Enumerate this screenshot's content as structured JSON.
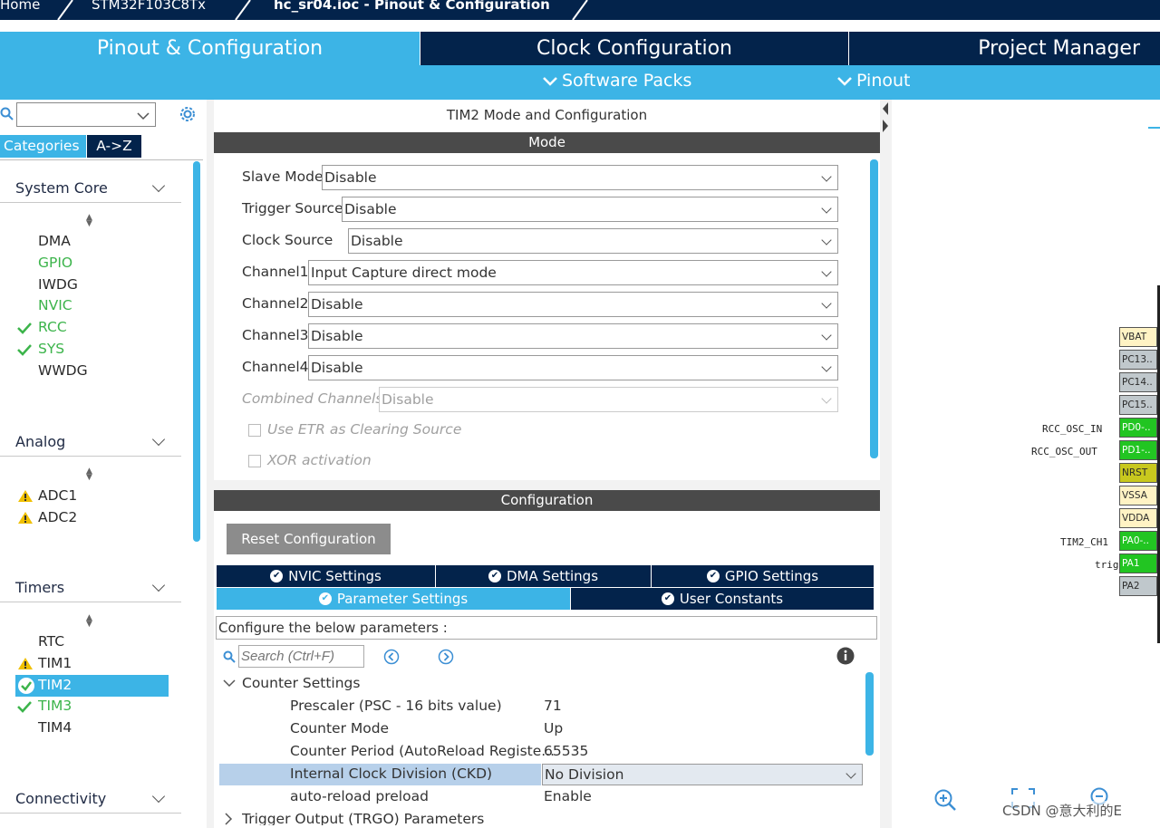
{
  "breadcrumb": {
    "home": "Home",
    "chip": "STM32F103C8Tx",
    "file": "hc_sr04.ioc - Pinout & Configuration"
  },
  "main_tabs": [
    {
      "label": "Pinout & Configuration",
      "active": true
    },
    {
      "label": "Clock Configuration",
      "active": false
    },
    {
      "label": "Project Manager",
      "active": false
    }
  ],
  "subbar": {
    "software_packs": "Software Packs",
    "pinout": "Pinout"
  },
  "sidebar": {
    "search_value": "",
    "tab_categories": "Categories",
    "tab_az": "A->Z",
    "sections": [
      {
        "title": "System Core",
        "items": [
          {
            "label": "DMA",
            "status": "none"
          },
          {
            "label": "GPIO",
            "status": "green"
          },
          {
            "label": "IWDG",
            "status": "none"
          },
          {
            "label": "NVIC",
            "status": "green"
          },
          {
            "label": "RCC",
            "status": "check"
          },
          {
            "label": "SYS",
            "status": "check"
          },
          {
            "label": "WWDG",
            "status": "none"
          }
        ]
      },
      {
        "title": "Analog",
        "items": [
          {
            "label": "ADC1",
            "status": "warning"
          },
          {
            "label": "ADC2",
            "status": "warning"
          }
        ]
      },
      {
        "title": "Timers",
        "items": [
          {
            "label": "RTC",
            "status": "none"
          },
          {
            "label": "TIM1",
            "status": "warning"
          },
          {
            "label": "TIM2",
            "status": "selected-check"
          },
          {
            "label": "TIM3",
            "status": "check"
          },
          {
            "label": "TIM4",
            "status": "none"
          }
        ]
      },
      {
        "title": "Connectivity",
        "items": []
      }
    ]
  },
  "mode_panel": {
    "title": "TIM2 Mode and Configuration",
    "mode_header": "Mode",
    "fields": [
      {
        "label": "Slave Mode",
        "value": "Disable"
      },
      {
        "label": "Trigger Source",
        "value": "Disable"
      },
      {
        "label": "Clock Source",
        "value": "Disable"
      },
      {
        "label": "Channel1",
        "value": "Input Capture direct mode"
      },
      {
        "label": "Channel2",
        "value": "Disable"
      },
      {
        "label": "Channel3",
        "value": "Disable"
      },
      {
        "label": "Channel4",
        "value": "Disable"
      },
      {
        "label": "Combined Channels",
        "value": "Disable"
      }
    ],
    "checkbox_etr": "Use ETR as Clearing Source",
    "checkbox_xor": "XOR activation"
  },
  "config_panel": {
    "header": "Configuration",
    "reset_button": "Reset Configuration",
    "tabs_row1": [
      "NVIC Settings",
      "DMA Settings",
      "GPIO Settings"
    ],
    "tabs_row2": [
      "Parameter Settings",
      "User Constants"
    ],
    "instruction": "Configure the below parameters :",
    "search_placeholder": "Search (Ctrl+F)",
    "group_counter": "Counter Settings",
    "params": [
      {
        "name": "Prescaler (PSC - 16 bits value)",
        "value": "71"
      },
      {
        "name": "Counter Mode",
        "value": "Up"
      },
      {
        "name": "Counter Period (AutoReload Registe...",
        "value": "65535"
      },
      {
        "name": "Internal Clock Division (CKD)",
        "value": "No Division"
      },
      {
        "name": "auto-reload preload",
        "value": "Enable"
      }
    ],
    "group_trgo": "Trigger Output (TRGO) Parameters"
  },
  "pinout": {
    "pins": [
      {
        "name": "VBAT",
        "color": "#fff3c4"
      },
      {
        "name": "PC13..",
        "color": "#c0c8cc"
      },
      {
        "name": "PC14..",
        "color": "#c0c8cc"
      },
      {
        "name": "PC15..",
        "color": "#c0c8cc"
      },
      {
        "name": "PD0-..",
        "color": "#22c522"
      },
      {
        "name": "PD1-..",
        "color": "#22c522"
      },
      {
        "name": "NRST",
        "color": "#c8c81e"
      },
      {
        "name": "VSSA",
        "color": "#fff3c4"
      },
      {
        "name": "VDDA",
        "color": "#fff3c4"
      },
      {
        "name": "PA0-..",
        "color": "#22c522"
      },
      {
        "name": "PA1",
        "color": "#22c522"
      },
      {
        "name": "PA2",
        "color": "#c0c8cc"
      }
    ],
    "labels": {
      "pd0": "RCC_OSC_IN",
      "pd1": "RCC_OSC_OUT",
      "pa0": "TIM2_CH1",
      "pa1": "trig"
    }
  },
  "watermark": "CSDN @意大利的E"
}
